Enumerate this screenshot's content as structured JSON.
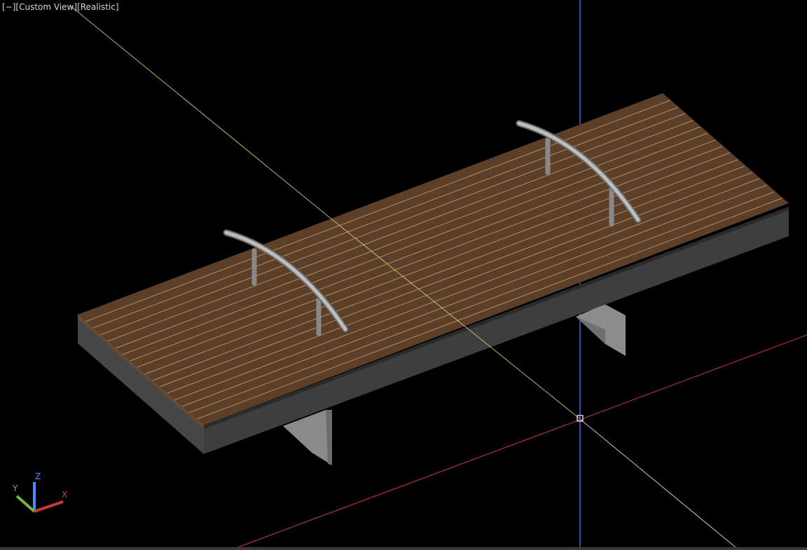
{
  "viewport": {
    "controls": {
      "minus": "[−]",
      "view": "[Custom View]",
      "visual_style": "[Realistic]"
    },
    "ucs_icon": {
      "x_label": "X",
      "y_label": "Y",
      "z_label": "Z"
    },
    "colors": {
      "background": "#000000",
      "wood_top": "#5b3f29",
      "wood_line": "#c49c6a",
      "side_dark": "#3d3d3d",
      "leg": "#8a8a8a",
      "handrail": "#a9a9a9",
      "x_axis": "#c83a3a",
      "y_axis": "#9fd068",
      "z_axis": "#4a8cff",
      "crosshair_blue": "#4a86ff",
      "crosshair_yellow": "#d8d86a"
    }
  }
}
